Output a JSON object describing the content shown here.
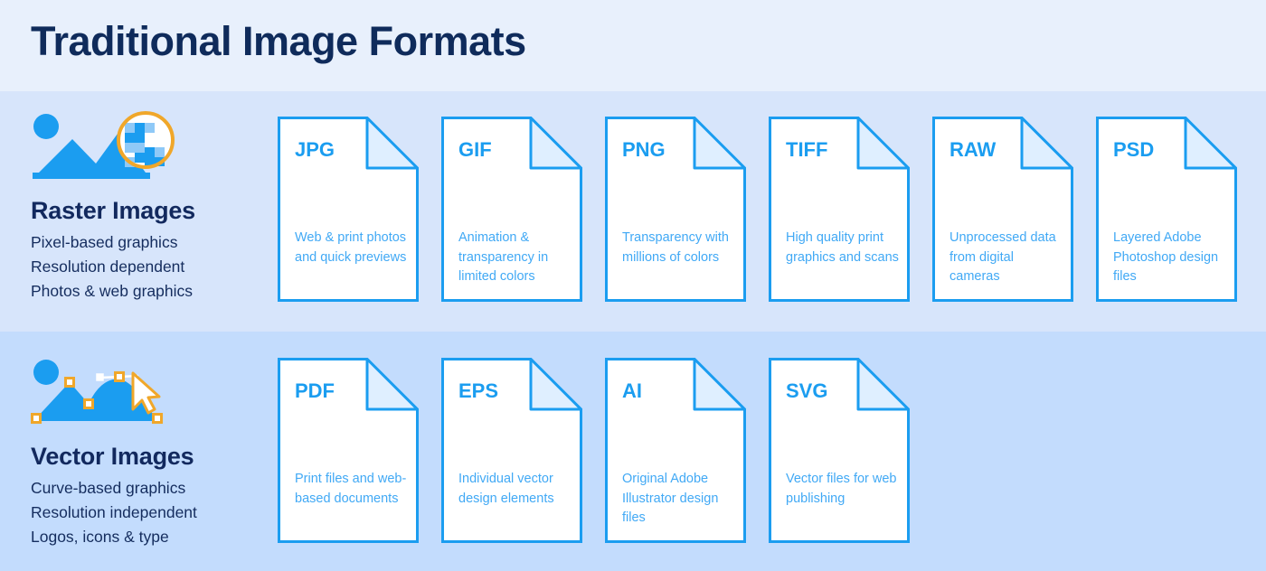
{
  "header": {
    "title": "Traditional Image Formats"
  },
  "colors": {
    "page_background": "#e8f0fc",
    "raster_band": "#d7e5fb",
    "vector_band": "#c3dcfd",
    "title_navy": "#0f2b5b",
    "card_border_blue": "#1b9df0",
    "card_fold_fill": "#dfefff",
    "card_label_blue": "#1b9df0",
    "card_text_blue": "#41a9f5",
    "icon_blue": "#1b9df0",
    "anchor_gold": "#f5a623"
  },
  "sections": [
    {
      "id": "raster",
      "icon": "raster-image-magnifier-icon",
      "heading": "Raster Images",
      "lines": [
        "Pixel-based graphics",
        "Resolution dependent",
        "Photos & web graphics"
      ],
      "cards": [
        {
          "ext": "JPG",
          "desc": "Web & print photos and quick previews"
        },
        {
          "ext": "GIF",
          "desc": "Animation & transparency in limited colors"
        },
        {
          "ext": "PNG",
          "desc": "Transparency with millions of colors"
        },
        {
          "ext": "TIFF",
          "desc": "High quality print graphics and scans"
        },
        {
          "ext": "RAW",
          "desc": "Unprocessed data from digital cameras"
        },
        {
          "ext": "PSD",
          "desc": "Layered Adobe Photoshop design files"
        }
      ]
    },
    {
      "id": "vector",
      "icon": "vector-image-anchor-points-icon",
      "heading": "Vector Images",
      "lines": [
        "Curve-based graphics",
        "Resolution independent",
        "Logos, icons & type"
      ],
      "cards": [
        {
          "ext": "PDF",
          "desc": "Print files and web-based documents"
        },
        {
          "ext": "EPS",
          "desc": "Individual vector design elements"
        },
        {
          "ext": "AI",
          "desc": "Original Adobe Illustrator design files"
        },
        {
          "ext": "SVG",
          "desc": "Vector files for web publishing"
        }
      ]
    }
  ]
}
